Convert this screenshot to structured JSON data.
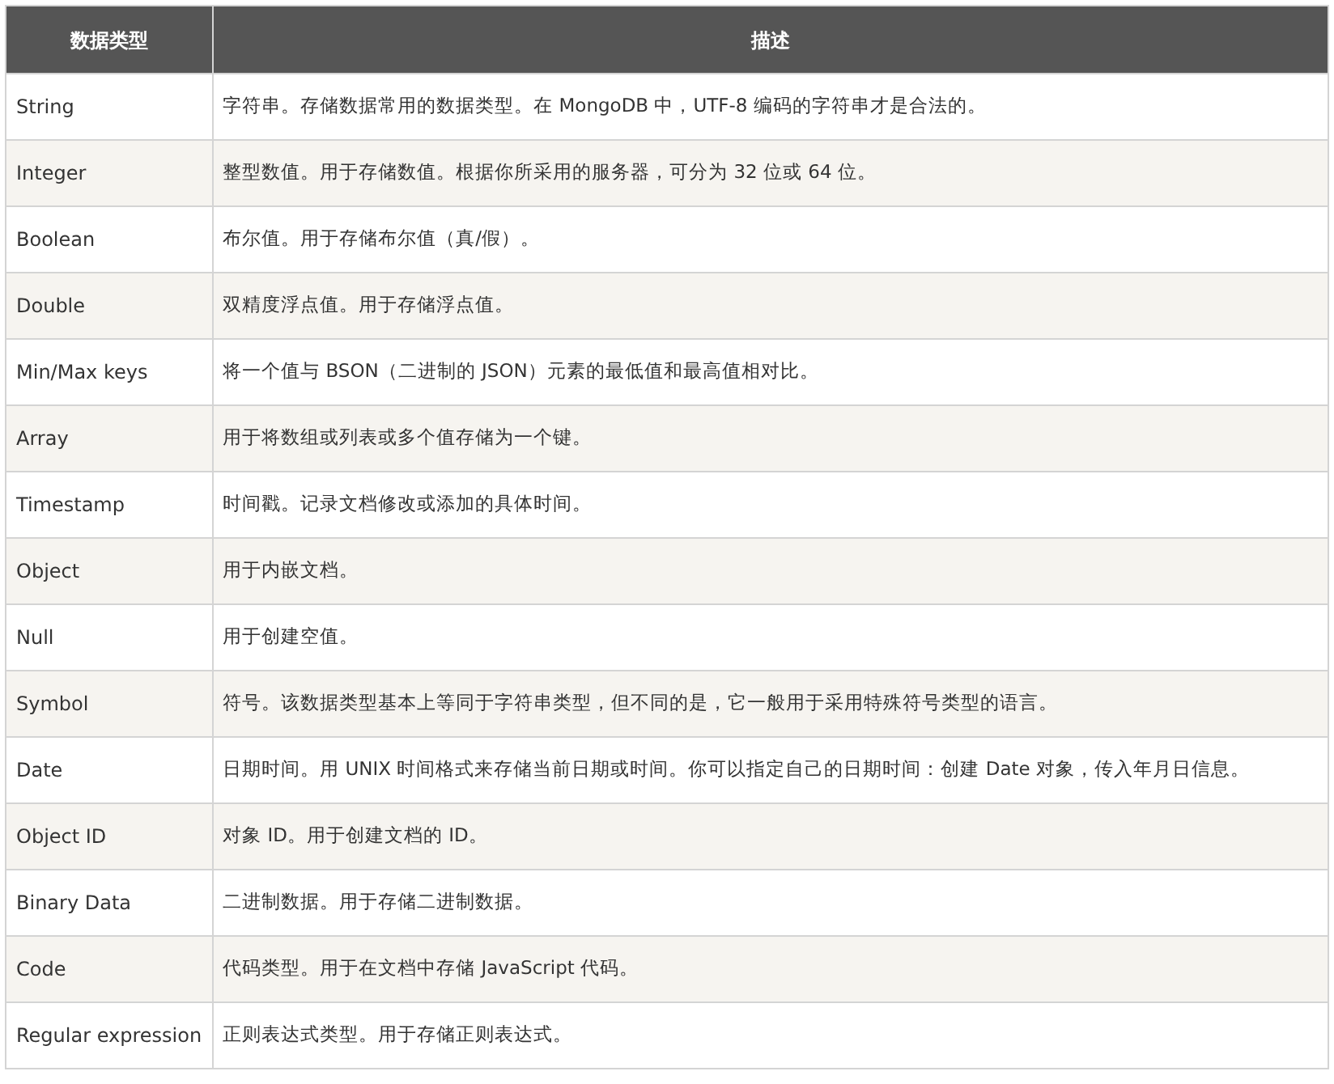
{
  "table": {
    "columns": [
      "数据类型",
      "描述"
    ],
    "rows": [
      {
        "type": "String",
        "description": "字符串。存储数据常用的数据类型。在 MongoDB 中，UTF-8 编码的字符串才是合法的。"
      },
      {
        "type": "Integer",
        "description": "整型数值。用于存储数值。根据你所采用的服务器，可分为 32 位或 64 位。"
      },
      {
        "type": "Boolean",
        "description": "布尔值。用于存储布尔值（真/假）。"
      },
      {
        "type": "Double",
        "description": "双精度浮点值。用于存储浮点值。"
      },
      {
        "type": "Min/Max keys",
        "description": "将一个值与 BSON（二进制的 JSON）元素的最低值和最高值相对比。"
      },
      {
        "type": "Array",
        "description": "用于将数组或列表或多个值存储为一个键。"
      },
      {
        "type": "Timestamp",
        "description": "时间戳。记录文档修改或添加的具体时间。"
      },
      {
        "type": "Object",
        "description": "用于内嵌文档。"
      },
      {
        "type": "Null",
        "description": "用于创建空值。"
      },
      {
        "type": "Symbol",
        "description": "符号。该数据类型基本上等同于字符串类型，但不同的是，它一般用于采用特殊符号类型的语言。"
      },
      {
        "type": "Date",
        "description": "日期时间。用 UNIX 时间格式来存储当前日期或时间。你可以指定自己的日期时间：创建 Date 对象，传入年月日信息。"
      },
      {
        "type": "Object ID",
        "description": "对象 ID。用于创建文档的 ID。"
      },
      {
        "type": "Binary Data",
        "description": "二进制数据。用于存储二进制数据。"
      },
      {
        "type": "Code",
        "description": "代码类型。用于在文档中存储 JavaScript 代码。"
      },
      {
        "type": "Regular expression",
        "description": "正则表达式类型。用于存储正则表达式。"
      }
    ]
  }
}
